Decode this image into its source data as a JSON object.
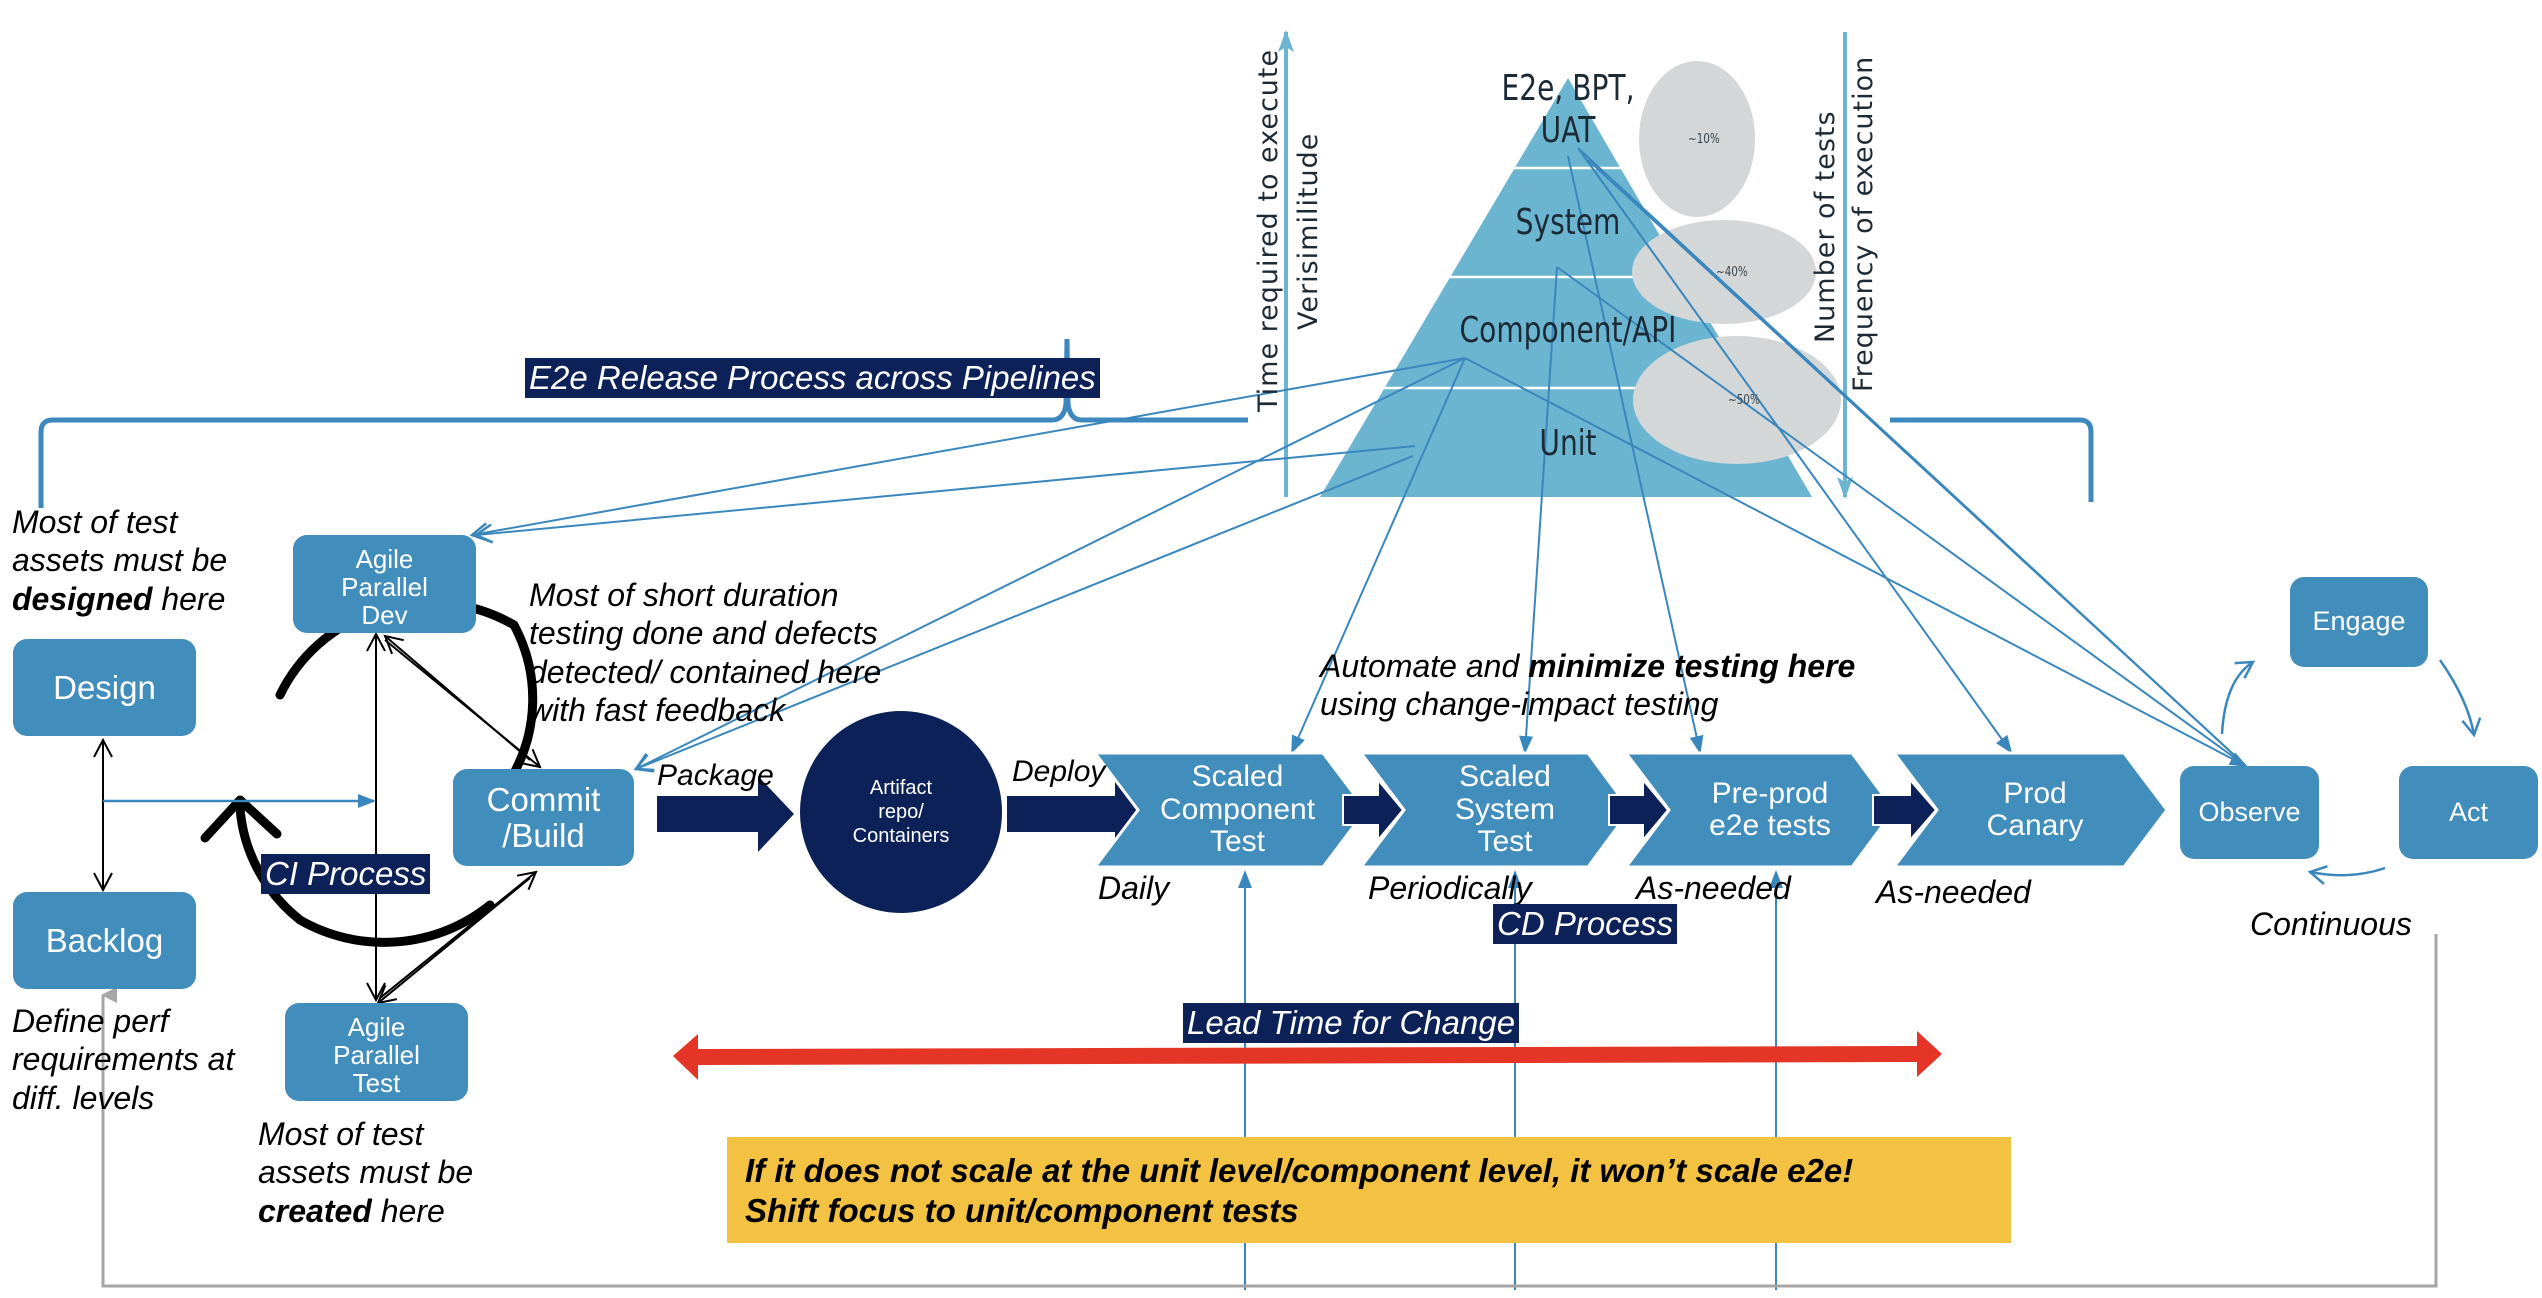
{
  "banner": {
    "release_process": "E2e Release Process across Pipelines"
  },
  "pyramid": {
    "levels": [
      {
        "name": "E2e, BPT,",
        "name2": "UAT",
        "share": "~10%"
      },
      {
        "name": "System",
        "share": "~40%"
      },
      {
        "name": "Component/API",
        "share": "~50%"
      },
      {
        "name": "Unit"
      }
    ],
    "left_axis": {
      "line1": "Time required to execute",
      "line2": "Verisimilitude"
    },
    "right_axis": {
      "line1": "Number of tests",
      "line2": "Frequency of execution"
    }
  },
  "left": {
    "design": "Design",
    "backlog": "Backlog",
    "note_designed": {
      "l1": "Most of test",
      "l2": "assets must be",
      "bold": "designed",
      "rest": " here"
    },
    "note_perf": {
      "l1": "Define perf",
      "l2": "requirements at",
      "l3": "diff. levels"
    }
  },
  "ci": {
    "agile_dev": {
      "l1": "Agile",
      "l2": "Parallel",
      "l3": "Dev"
    },
    "agile_test": {
      "l1": "Agile",
      "l2": "Parallel",
      "l3": "Test"
    },
    "commit": {
      "l1": "Commit",
      "l2": "/Build"
    },
    "label": "CI Process",
    "note_short": {
      "l1": "Most of short duration",
      "l2": "testing done and defects",
      "l3": "detected/ contained here",
      "l4": "with fast feedback"
    },
    "note_created": {
      "l1": "Most of test",
      "l2": "assets must be",
      "bold": "created",
      "rest": " here"
    }
  },
  "flow": {
    "package": "Package",
    "artifact": {
      "l1": "Artifact",
      "l2": "repo/",
      "l3": "Containers"
    },
    "deploy": "Deploy"
  },
  "cd": {
    "note": {
      "pre": "Automate and ",
      "bold": "minimize testing here",
      "l2": "using change-impact testing"
    },
    "stages": [
      {
        "l1": "Scaled",
        "l2": "Component",
        "l3": "Test",
        "freq": "Daily"
      },
      {
        "l1": "Scaled",
        "l2": "System",
        "l3": "Test",
        "freq": "Periodically"
      },
      {
        "l1": "Pre-prod",
        "l2": "e2e tests",
        "l3": "",
        "freq": "As-needed"
      },
      {
        "l1": "Prod",
        "l2": "Canary",
        "l3": "",
        "freq": "As-needed"
      }
    ],
    "label": "CD Process"
  },
  "ops": {
    "observe": "Observe",
    "engage": "Engage",
    "act": "Act",
    "continuous": "Continuous"
  },
  "lead_time": {
    "label": "Lead Time for Change"
  },
  "callout": {
    "line1": "If it does not scale at the unit level/component level, it won’t scale e2e!",
    "line2": "Shift focus to unit/component tests"
  },
  "colors": {
    "box_blue": "#418dbc",
    "pyramid_blue": "#6cb5d1",
    "navy": "#0c2157",
    "ellipse_gray": "#d3d7d8",
    "red": "#e53527",
    "yellow": "#f4c242",
    "line_blue": "#3a87bd",
    "gray": "#a6a6a6"
  }
}
